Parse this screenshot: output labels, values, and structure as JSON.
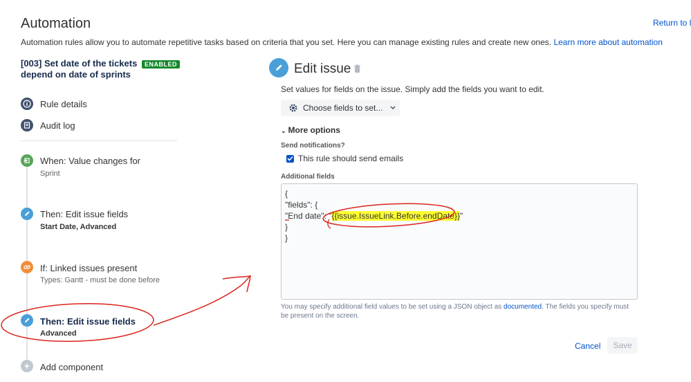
{
  "header": {
    "title": "Automation",
    "return_link": "Return to lis",
    "subtitle": "Automation rules allow you to automate repetitive tasks based on criteria that you set. Here you can manage existing rules and create new ones. ",
    "learn_more": "Learn more about automation"
  },
  "rule": {
    "name": "[003] Set date of the tickets depend on date of sprints",
    "status": "ENABLED"
  },
  "nav": [
    {
      "label": "Rule details",
      "icon": "info-icon"
    },
    {
      "label": "Audit log",
      "icon": "log-icon"
    }
  ],
  "components": [
    {
      "title": "When: Value changes for",
      "sub": "Sprint",
      "color": "#57a55a",
      "icon": "trigger-icon"
    },
    {
      "title": "Then: Edit issue fields",
      "sub": "Start Date, Advanced",
      "color": "#4a9fd8",
      "icon": "pencil-icon"
    },
    {
      "title": "If: Linked issues present",
      "sub": "Types: Gantt - must be done before",
      "color": "#f18d3b",
      "icon": "link-icon"
    },
    {
      "title": "Then: Edit issue fields",
      "sub": "Advanced",
      "color": "#4a9fd8",
      "icon": "pencil-icon"
    }
  ],
  "add_component": "Add component",
  "editor": {
    "title": "Edit issue",
    "description": "Set values for fields on the issue. Simply add the fields you want to edit.",
    "choose_fields": "Choose fields to set...",
    "more_options": "More options",
    "send_notifications_label": "Send notifications?",
    "send_emails": "This rule should send emails",
    "additional_fields_label": "Additional fields",
    "json_lines": [
      "{",
      "\"fields\": {",
      "\"End date\": \"",
      "}",
      "}"
    ],
    "json_highlight": "{{issue.IssueLink.Before.endDate}}",
    "json_tail": "\"",
    "help_prefix": "You may specify additional field values to be set using a JSON object as ",
    "help_link": "documented",
    "help_suffix": ". The fields you specify must be present on the screen.",
    "cancel": "Cancel",
    "save": "Save"
  },
  "colors": {
    "accent": "#0052cc",
    "enabled": "#14892c",
    "annotation": "#d9251c"
  }
}
